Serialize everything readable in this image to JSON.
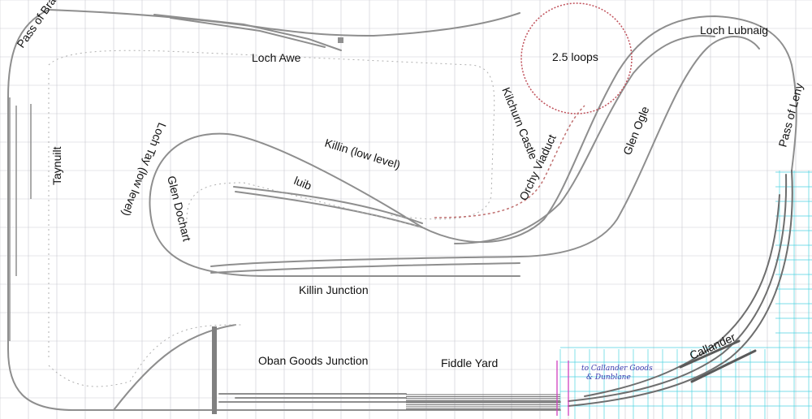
{
  "labels": {
    "pass_of_brander": "Pass of Brander",
    "loch_awe": "Loch Awe",
    "loops": "2.5 loops",
    "loch_lubnaig": "Loch Lubnaig",
    "kilchurn_castle": "Kilchurn Castle",
    "glen_ogle": "Glen Ogle",
    "pass_of_leny": "Pass of Leny",
    "taynuilt": "Taynuilt",
    "loch_tay": "Loch Tay (low level)",
    "glen_dochart": "Glen Dochart",
    "killin_low": "Killin (low level)",
    "luib": "luib",
    "orchy_viaduct": "Orchy Viaduct",
    "killin_junction": "Killin Junction",
    "oban_goods_junction": "Oban Goods Junction",
    "fiddle_yard": "Fiddle Yard",
    "callander": "Callander",
    "to_callander_goods_1": "to Callander Goods",
    "to_callander_goods_2": "& Dunblane"
  },
  "colors": {
    "grid": "#c9c9d1",
    "grid_cyan": "#4fd3e0",
    "track": "#8e8e8e",
    "track_dark": "#5a5a5a",
    "helix": "#c0505a",
    "magenta": "#d040c0"
  }
}
